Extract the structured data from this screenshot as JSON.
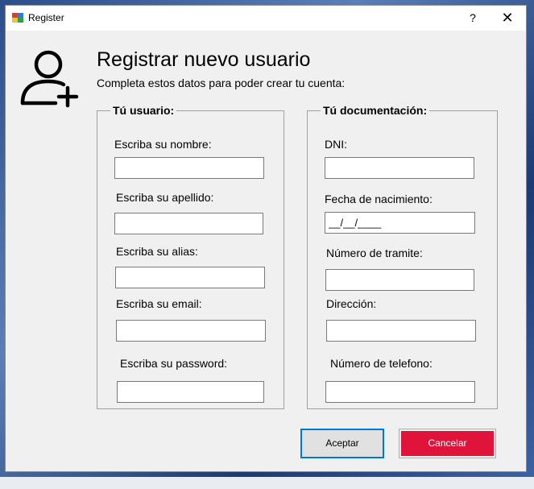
{
  "window": {
    "title": "Register",
    "help_glyph": "?",
    "close_glyph": "✕"
  },
  "header": {
    "icon": "add-user-icon",
    "title": "Registrar nuevo usuario",
    "subtitle": "Completa estos datos para poder crear tu cuenta:"
  },
  "user_group": {
    "legend": "Tú usuario:",
    "name_label": "Escriba su nombre:",
    "lastname_label": "Escriba su apellido:",
    "alias_label": "Escriba su alias:",
    "email_label": "Escriba su email:",
    "password_label": "Escriba su password:",
    "name_value": "",
    "lastname_value": "",
    "alias_value": "",
    "email_value": "",
    "password_value": ""
  },
  "doc_group": {
    "legend": "Tú documentación:",
    "dni_label": "DNI:",
    "birth_label": "Fecha de nacimiento:",
    "birth_mask": "__/__/____",
    "tramite_label": "Número de tramite:",
    "address_label": "Dirección:",
    "phone_label": "Número de telefono:",
    "dni_value": "",
    "tramite_value": "",
    "address_value": "",
    "phone_value": ""
  },
  "buttons": {
    "accept": "Aceptar",
    "cancel": "Cancelar"
  },
  "colors": {
    "accept_border": "#0078d7",
    "cancel_bg": "#e0133a"
  }
}
